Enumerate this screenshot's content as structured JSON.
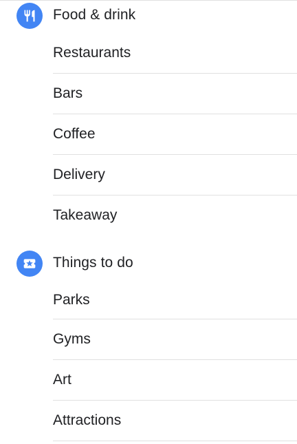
{
  "food_drink": {
    "title": "Food & drink",
    "icon": "fork-knife-icon",
    "items": [
      {
        "label": "Restaurants"
      },
      {
        "label": "Bars"
      },
      {
        "label": "Coffee"
      },
      {
        "label": "Delivery"
      },
      {
        "label": "Takeaway"
      }
    ]
  },
  "things_to_do": {
    "title": "Things to do",
    "icon": "ticket-icon",
    "items": [
      {
        "label": "Parks"
      },
      {
        "label": "Gyms"
      },
      {
        "label": "Art"
      },
      {
        "label": "Attractions"
      }
    ]
  },
  "colors": {
    "accent": "#4285f4",
    "text": "#202124",
    "divider": "#e0e0e0"
  }
}
